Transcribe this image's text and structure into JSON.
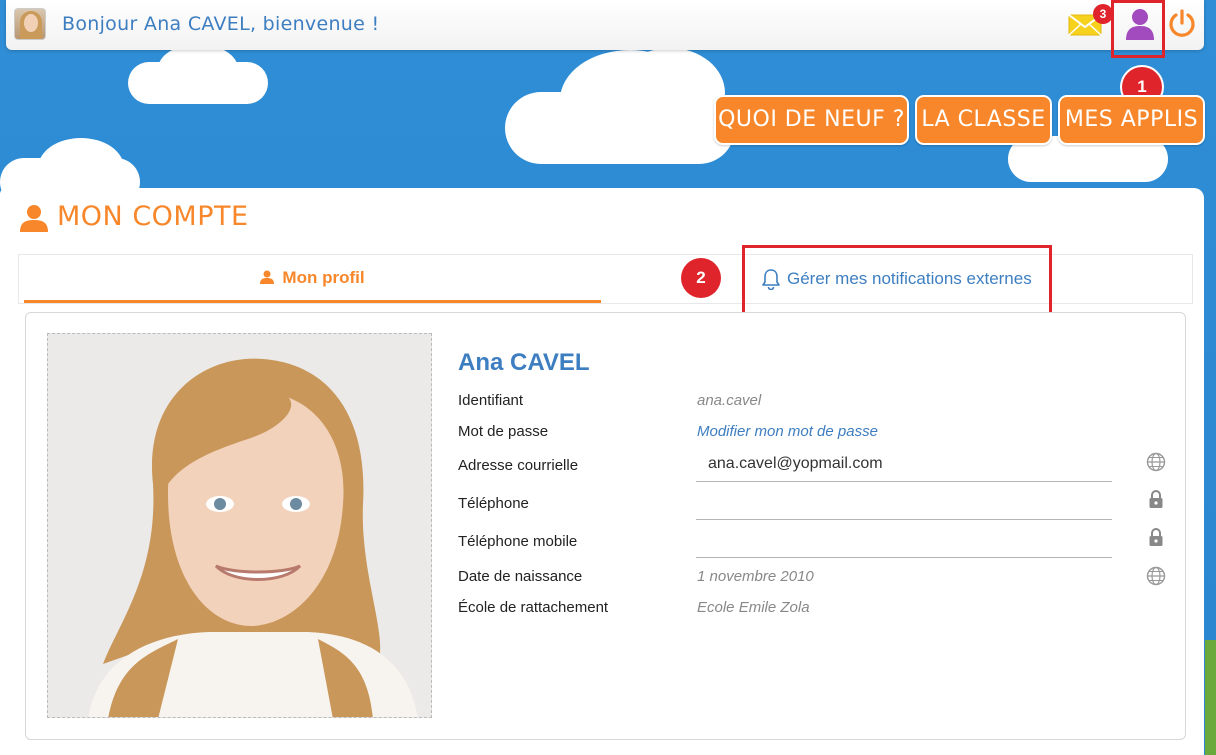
{
  "header": {
    "greeting": "Bonjour Ana CAVEL, bienvenue !",
    "mail_badge_count": "3",
    "step1": "1"
  },
  "nav": {
    "quoi_de_neuf": "QUOI DE NEUF ?",
    "la_classe": "LA CLASSE",
    "mes_applis": "MES APPLIS"
  },
  "page": {
    "title": "MON COMPTE"
  },
  "tabs": {
    "profil": "Mon profil",
    "notifications": "Gérer mes notifications externes",
    "step2": "2"
  },
  "profile": {
    "name": "Ana CAVEL",
    "rows": [
      {
        "label": "Identifiant",
        "value": "ana.cavel"
      },
      {
        "label": "Mot de passe",
        "value": "Modifier mon mot de passe"
      },
      {
        "label": "Adresse courrielle",
        "value": "ana.cavel@yopmail.com"
      },
      {
        "label": "Téléphone",
        "value": ""
      },
      {
        "label": "Téléphone mobile",
        "value": ""
      },
      {
        "label": "Date de naissance",
        "value": "1 novembre 2010"
      },
      {
        "label": "École de rattachement",
        "value": "Ecole Emile Zola"
      }
    ]
  },
  "colors": {
    "accent_orange": "#f7872a",
    "accent_blue": "#3d7ec1",
    "highlight_red": "#e0242c",
    "user_purple": "#a24bbf"
  }
}
